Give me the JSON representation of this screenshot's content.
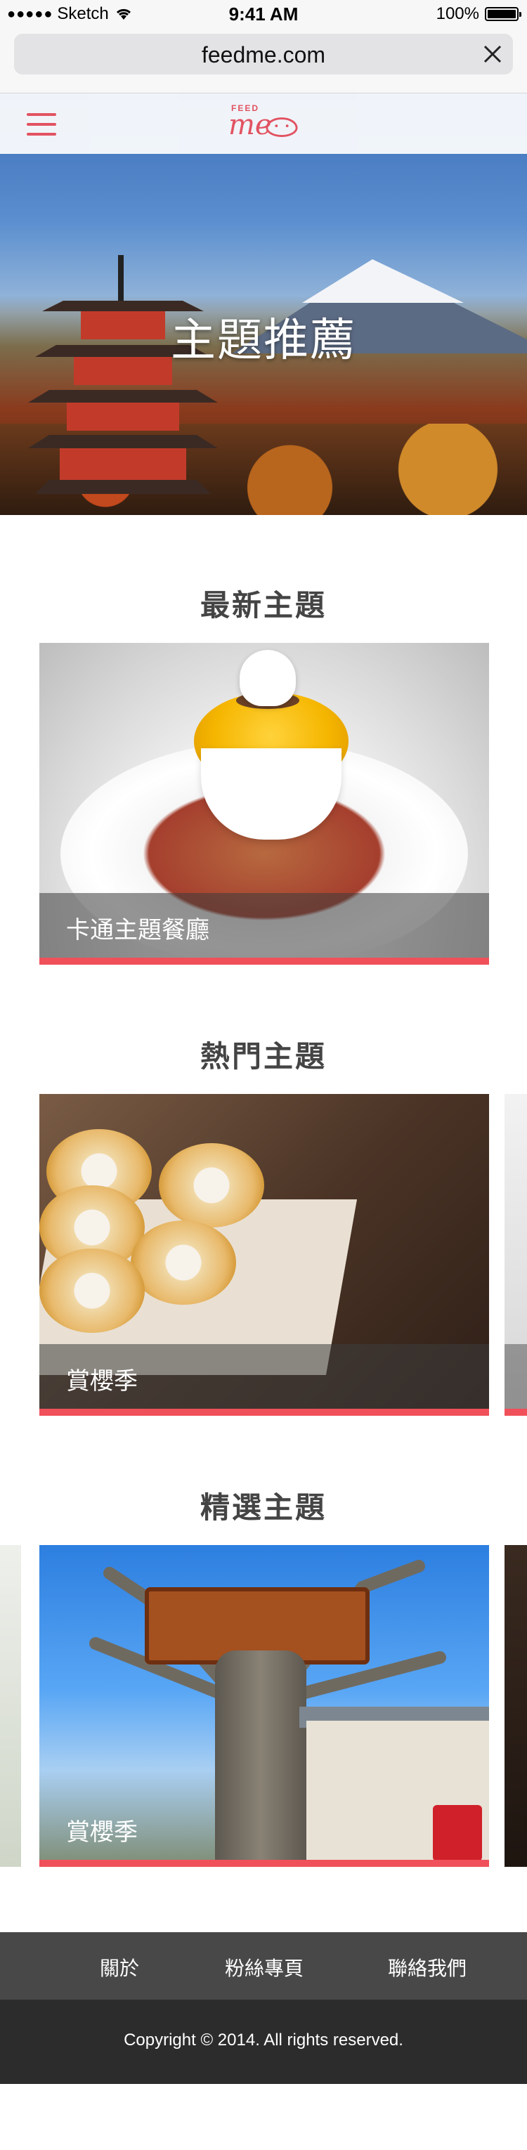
{
  "status_bar": {
    "carrier": "Sketch",
    "time": "9:41 AM",
    "battery": "100%"
  },
  "browser": {
    "url": "feedme.com"
  },
  "app": {
    "logo_small": "FEED",
    "logo_main": "me"
  },
  "hero": {
    "title": "主題推薦"
  },
  "sections": [
    {
      "title": "最新主題",
      "card_label": "卡通主題餐廳"
    },
    {
      "title": "熱門主題",
      "card_label": "賞櫻季"
    },
    {
      "title": "精選主題",
      "card_label": "賞櫻季"
    }
  ],
  "footer": {
    "links": [
      "關於",
      "粉絲專頁",
      "聯絡我們"
    ],
    "copyright": "Copyright © 2014. All rights reserved."
  },
  "colors": {
    "accent": "#f0505a",
    "footer_nav": "#484848",
    "footer_copy": "#2c2c2c"
  }
}
